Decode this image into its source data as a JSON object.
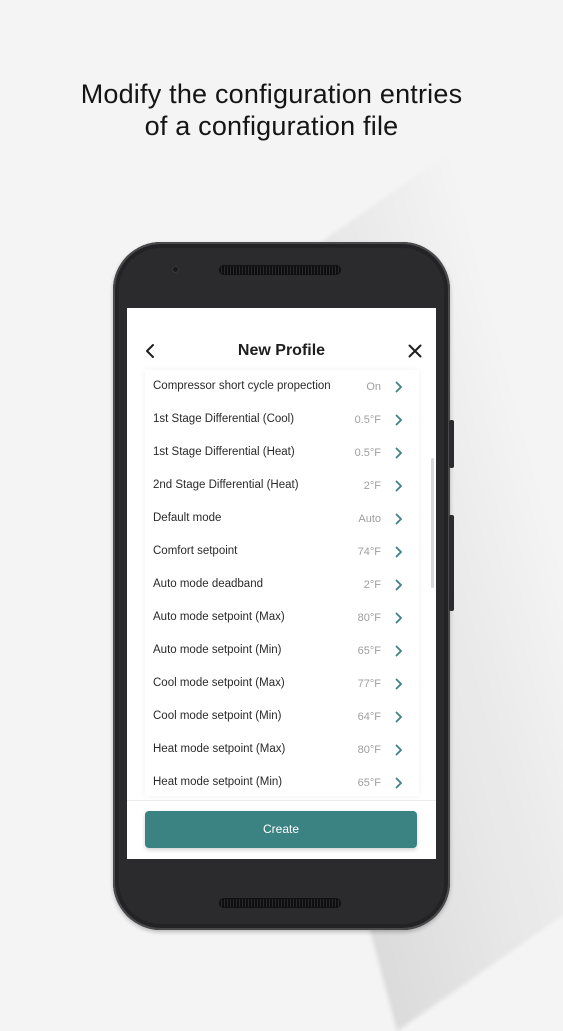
{
  "headline": {
    "line1": "Modify the configuration entries",
    "line2": "of a configuration file"
  },
  "colors": {
    "accent": "#3b8283",
    "chevron": "#3b8283",
    "value_text": "#9e9e9e",
    "background": "#f4f4f4"
  },
  "nav": {
    "title": "New Profile",
    "back_icon": "chevron-left-icon",
    "close_icon": "close-icon"
  },
  "settings": [
    {
      "label": "Compressor short cycle propection",
      "value": "On"
    },
    {
      "label": "1st Stage Differential (Cool)",
      "value": "0.5°F"
    },
    {
      "label": "1st Stage Differential (Heat)",
      "value": "0.5°F"
    },
    {
      "label": "2nd Stage Differential (Heat)",
      "value": "2°F"
    },
    {
      "label": "Default mode",
      "value": "Auto"
    },
    {
      "label": "Comfort setpoint",
      "value": "74°F"
    },
    {
      "label": "Auto mode deadband",
      "value": "2°F"
    },
    {
      "label": "Auto mode setpoint (Max)",
      "value": "80°F"
    },
    {
      "label": "Auto mode setpoint (Min)",
      "value": "65°F"
    },
    {
      "label": "Cool mode setpoint (Max)",
      "value": "77°F"
    },
    {
      "label": "Cool mode setpoint (Min)",
      "value": "64°F"
    },
    {
      "label": "Heat mode setpoint (Max)",
      "value": "80°F"
    },
    {
      "label": "Heat mode setpoint (Min)",
      "value": "65°F"
    }
  ],
  "footer": {
    "create_label": "Create"
  }
}
